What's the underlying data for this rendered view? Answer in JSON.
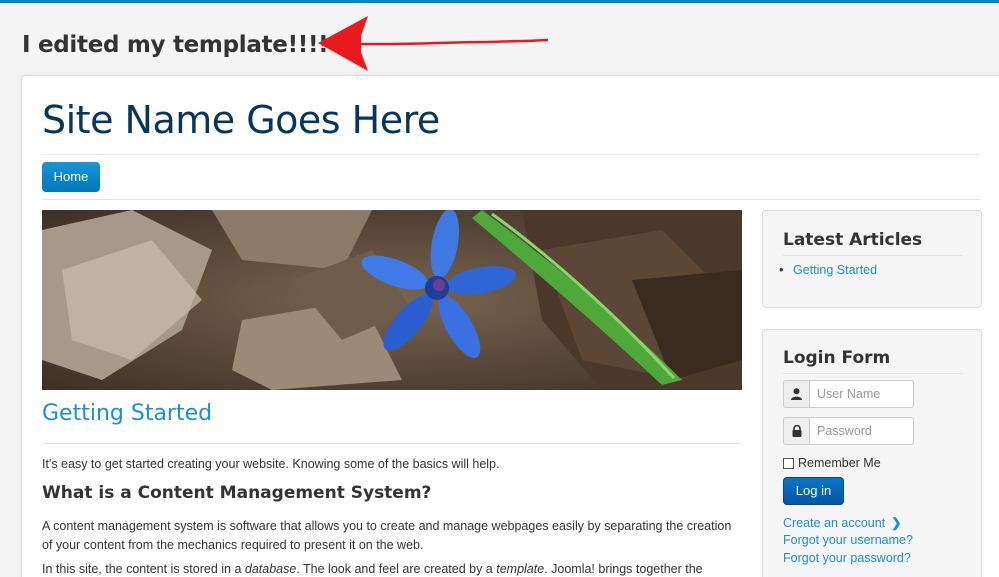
{
  "annotation": {
    "title": "I edited my template!!!!",
    "arrow_color": "#e8191f"
  },
  "header": {
    "site_name": "Site Name Goes Here"
  },
  "nav": {
    "home_label": "Home"
  },
  "article": {
    "title": "Getting Started",
    "intro": "It's easy to get started creating your website. Knowing some of the basics will help.",
    "heading": "What is a Content Management System?",
    "paragraph1": "A content management system is software that allows you to create and manage webpages easily by separating the creation of your content from the mechanics required to present it on the web.",
    "paragraph2_start": "In this site, the content is stored in a ",
    "paragraph2_em1": "database",
    "paragraph2_mid": ". The look and feel are created by a ",
    "paragraph2_em2": "template",
    "paragraph2_end": ". Joomla! brings together the"
  },
  "latest_articles": {
    "title": "Latest Articles",
    "items": [
      "Getting Started"
    ]
  },
  "login_form": {
    "title": "Login Form",
    "username_placeholder": "User Name",
    "password_placeholder": "Password",
    "remember_label": "Remember Me",
    "login_button": "Log in",
    "create_account": "Create an account",
    "forgot_username": "Forgot your username?",
    "forgot_password": "Forgot your password?"
  },
  "colors": {
    "accent": "#0088cc",
    "site_name": "#08365a",
    "link": "#1a8fd1",
    "login_button": "#0866b8"
  }
}
